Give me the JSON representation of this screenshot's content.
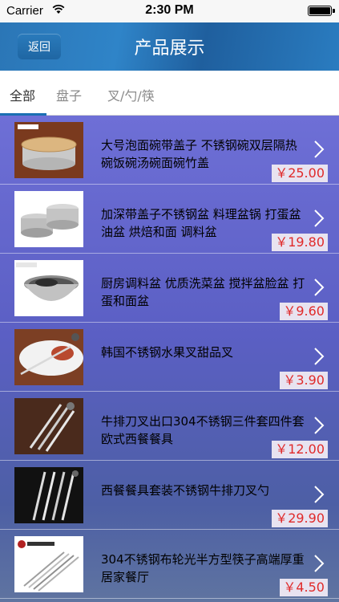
{
  "status_bar": {
    "carrier": "Carrier",
    "time": "2:30 PM"
  },
  "nav": {
    "back_label": "返回",
    "title": "产品展示"
  },
  "tabs": [
    {
      "label": "全部",
      "selected": true
    },
    {
      "label": "盘子",
      "selected": false
    },
    {
      "label": "叉/勺/筷",
      "selected": false
    }
  ],
  "products": [
    {
      "title": "大号泡面碗带盖子 不锈钢碗双层隔热碗饭碗汤碗面碗竹盖",
      "price": "￥25.00"
    },
    {
      "title": "加深带盖子不锈钢盆 料理盆锅 打蛋盆 油盆 烘焙和面 调料盆",
      "price": "￥19.80"
    },
    {
      "title": "厨房调料盆 优质洗菜盆 搅拌盆脸盆 打蛋和面盆",
      "price": "￥9.60"
    },
    {
      "title": "韩国不锈钢水果叉甜品叉",
      "price": "￥3.90"
    },
    {
      "title": "牛排刀叉出口304不锈钢三件套四件套欧式西餐餐具",
      "price": "￥12.00"
    },
    {
      "title": "西餐餐具套装不锈钢牛排刀叉勺",
      "price": "￥29.90"
    },
    {
      "title": "304不锈钢布轮光半方型筷子高端厚重居家餐厅",
      "price": "￥4.50"
    }
  ],
  "colors": {
    "nav_bar": "#2b76b6",
    "tab_indicator": "#1a6fb3",
    "price_text": "#e02a2a",
    "list_background": "#6e6fd6"
  }
}
